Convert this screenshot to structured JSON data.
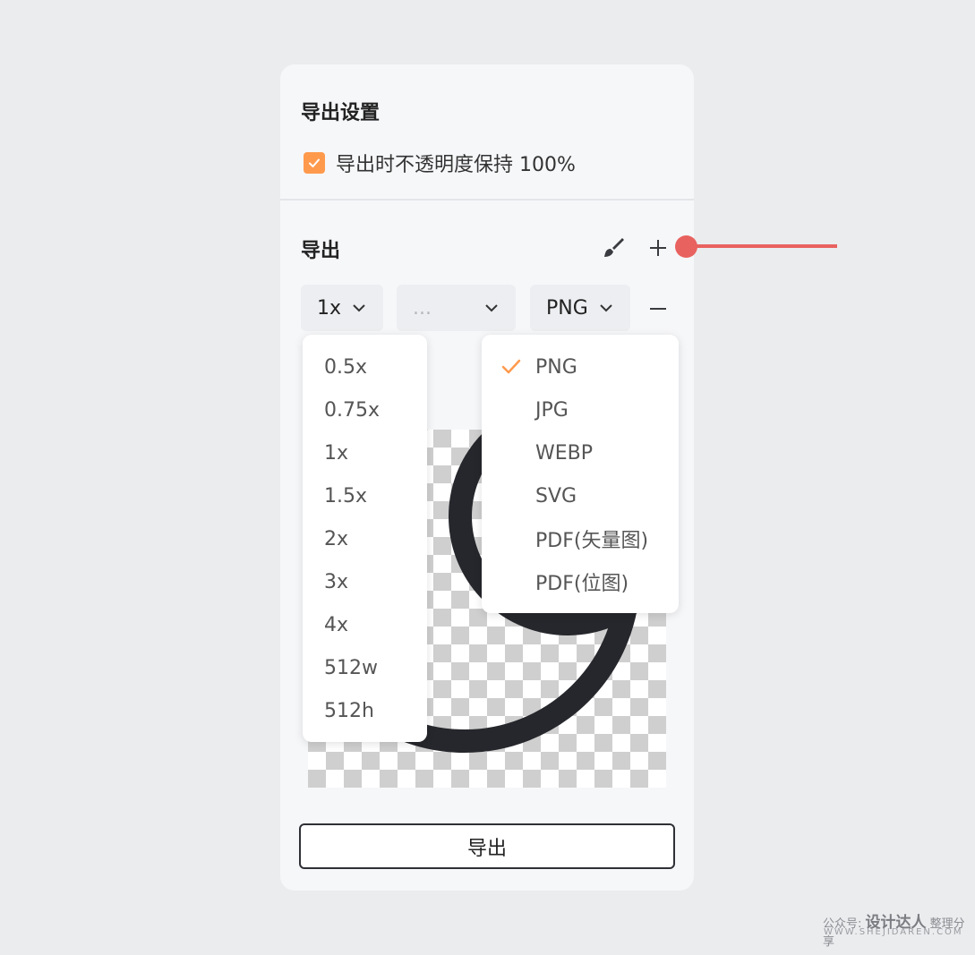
{
  "settings": {
    "title": "导出设置",
    "opacity_checkbox_label": "导出时不透明度保持 100%",
    "opacity_checked": true
  },
  "export": {
    "title": "导出",
    "scale_value": "1x",
    "name_placeholder": "...",
    "format_value": "PNG",
    "export_button_label": "导出"
  },
  "scale_menu": {
    "items": [
      "0.5x",
      "0.75x",
      "1x",
      "1.5x",
      "2x",
      "3x",
      "4x",
      "512w",
      "512h"
    ]
  },
  "format_menu": {
    "items": [
      "PNG",
      "JPG",
      "WEBP",
      "SVG",
      "PDF(矢量图)",
      "PDF(位图)"
    ],
    "selected": "PNG"
  },
  "icons": {
    "brush": "brush-icon",
    "plus": "plus-icon",
    "minus": "minus-icon",
    "chevron": "chevron-down-icon",
    "check": "check-icon"
  },
  "colors": {
    "accent": "#ff9a4d",
    "annotation": "#e8625f",
    "artwork": "#26272c"
  },
  "watermark": {
    "prefix": "公众号:",
    "brand": "设计达人",
    "suffix": "整理分享",
    "url": "WWW.SHEJIDAREN.COM"
  }
}
